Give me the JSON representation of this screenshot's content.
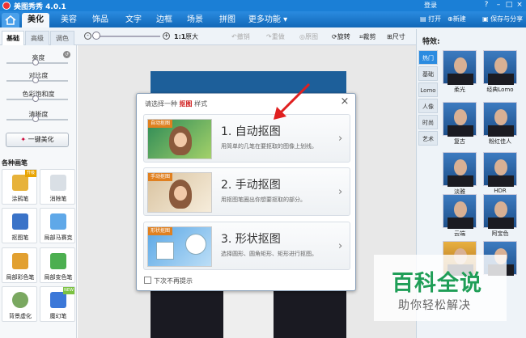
{
  "app": {
    "title": "美图秀秀 4.0.1",
    "login": "登录"
  },
  "menu": {
    "tabs": [
      "美化",
      "美容",
      "饰品",
      "文字",
      "边框",
      "场景",
      "拼图",
      "更多功能"
    ],
    "open": "打开",
    "new": "新建",
    "save_share": "保存与分享"
  },
  "subtabs": [
    "基础",
    "高级",
    "调色"
  ],
  "toolbar": {
    "zoom_original": "1:1",
    "original_size": "原大",
    "undo": "撤销",
    "redo": "重做",
    "original_image": "原图",
    "rotate": "旋转",
    "crop": "裁剪",
    "size": "尺寸"
  },
  "adjustments": [
    "亮度",
    "对比度",
    "色彩饱和度",
    "清晰度"
  ],
  "beautify_button": "一键美化",
  "pens": {
    "title": "各种画笔",
    "items": [
      {
        "label": "涂鸦笔",
        "badge": "升级",
        "color": "#e7b23a"
      },
      {
        "label": "消除笔",
        "badge": "",
        "color": "#d9dfe5"
      },
      {
        "label": "抠图笔",
        "badge": "",
        "color": "#3a73c8"
      },
      {
        "label": "局部马赛克",
        "badge": "",
        "color": "#5fa8e8"
      },
      {
        "label": "局部彩色笔",
        "badge": "",
        "color": "#e2a030"
      },
      {
        "label": "局部变色笔",
        "badge": "",
        "color": "#4caf50"
      },
      {
        "label": "背景虚化",
        "badge": "",
        "color": "#7aa860"
      },
      {
        "label": "魔幻笔",
        "badge": "NEW",
        "color": "#3c78d8"
      }
    ]
  },
  "dialog": {
    "prefix": "请选择一种",
    "highlight": "抠图",
    "suffix": "样式",
    "options": [
      {
        "tag": "自动抠图",
        "title": "1. 自动抠图",
        "desc": "用简单的几笔在要抠取的图像上划线。"
      },
      {
        "tag": "手动抠图",
        "title": "2. 手动抠图",
        "desc": "用抠图笔圈出你想要抠取的部分。"
      },
      {
        "tag": "形状抠图",
        "title": "3. 形状抠图",
        "desc": "选择圆形、圆角矩形、矩形进行抠图。"
      }
    ],
    "dont_show": "下次不再提示"
  },
  "effects": {
    "title": "特效:",
    "categories": [
      "热门",
      "基础",
      "Lomo",
      "人像",
      "时尚",
      "艺术"
    ],
    "items": [
      "柔光",
      "经典Lomo",
      "复古",
      "粉红佳人",
      "淡雅",
      "HDR",
      "云端",
      "阿宝色"
    ]
  },
  "watermark": {
    "title": "百科全说",
    "subtitle": "助你轻松解决"
  }
}
